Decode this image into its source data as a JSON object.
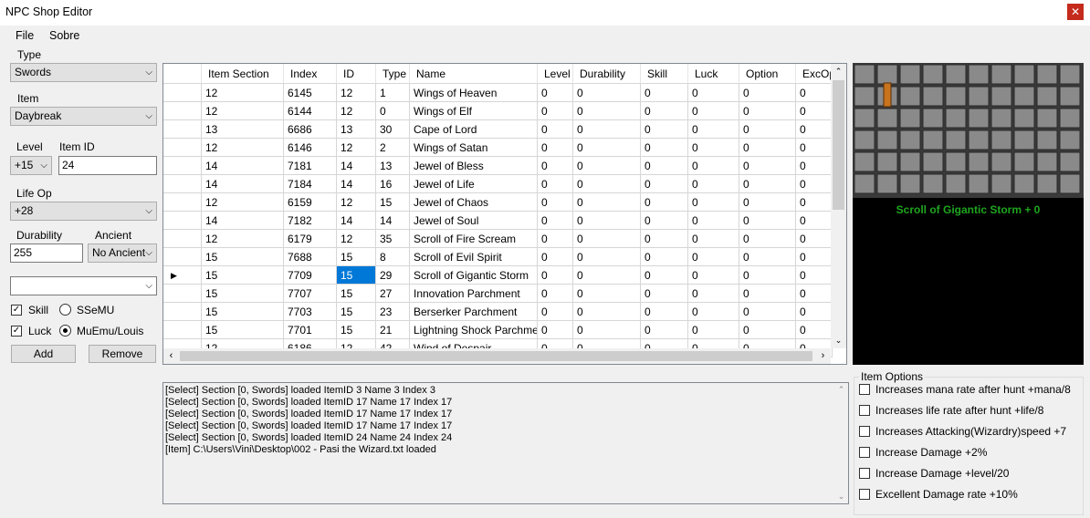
{
  "window": {
    "title": "NPC Shop Editor",
    "close_glyph": "✕"
  },
  "menu": {
    "file": "File",
    "sobre": "Sobre"
  },
  "left": {
    "type_label": "Type",
    "type_value": "Swords",
    "item_label": "Item",
    "item_value": "Daybreak",
    "level_label": "Level",
    "level_value": "+15",
    "item_id_label": "Item ID",
    "item_id_value": "24",
    "life_op_label": "Life Op",
    "life_op_value": "+28",
    "durability_label": "Durability",
    "durability_value": "255",
    "ancient_label": "Ancient",
    "ancient_value": "No Ancient",
    "extra_value": "",
    "skill_label": "Skill",
    "skill_checked": true,
    "luck_label": "Luck",
    "luck_checked": true,
    "ssemu_label": "SSeMU",
    "ssemu_selected": false,
    "muemu_label": "MuEmu/Louis",
    "muemu_selected": true,
    "add_label": "Add",
    "remove_label": "Remove"
  },
  "grid": {
    "columns": [
      "Item Section",
      "Index",
      "ID",
      "Type",
      "Name",
      "Level",
      "Durability",
      "Skill",
      "Luck",
      "Option",
      "ExcOp"
    ],
    "rows": [
      [
        "12",
        "6145",
        "12",
        "1",
        "Wings of Heaven",
        "0",
        "0",
        "0",
        "0",
        "0",
        "0"
      ],
      [
        "12",
        "6144",
        "12",
        "0",
        "Wings of Elf",
        "0",
        "0",
        "0",
        "0",
        "0",
        "0"
      ],
      [
        "13",
        "6686",
        "13",
        "30",
        "Cape of Lord",
        "0",
        "0",
        "0",
        "0",
        "0",
        "0"
      ],
      [
        "12",
        "6146",
        "12",
        "2",
        "Wings of Satan",
        "0",
        "0",
        "0",
        "0",
        "0",
        "0"
      ],
      [
        "14",
        "7181",
        "14",
        "13",
        "Jewel of Bless",
        "0",
        "0",
        "0",
        "0",
        "0",
        "0"
      ],
      [
        "14",
        "7184",
        "14",
        "16",
        "Jewel of Life",
        "0",
        "0",
        "0",
        "0",
        "0",
        "0"
      ],
      [
        "12",
        "6159",
        "12",
        "15",
        "Jewel of Chaos",
        "0",
        "0",
        "0",
        "0",
        "0",
        "0"
      ],
      [
        "14",
        "7182",
        "14",
        "14",
        "Jewel of Soul",
        "0",
        "0",
        "0",
        "0",
        "0",
        "0"
      ],
      [
        "12",
        "6179",
        "12",
        "35",
        "Scroll of Fire Scream",
        "0",
        "0",
        "0",
        "0",
        "0",
        "0"
      ],
      [
        "15",
        "7688",
        "15",
        "8",
        "Scroll of Evil Spirit",
        "0",
        "0",
        "0",
        "0",
        "0",
        "0"
      ],
      [
        "15",
        "7709",
        "15",
        "29",
        "Scroll of Gigantic Storm",
        "0",
        "0",
        "0",
        "0",
        "0",
        "0"
      ],
      [
        "15",
        "7707",
        "15",
        "27",
        "Innovation Parchment",
        "0",
        "0",
        "0",
        "0",
        "0",
        "0"
      ],
      [
        "15",
        "7703",
        "15",
        "23",
        "Berserker Parchment",
        "0",
        "0",
        "0",
        "0",
        "0",
        "0"
      ],
      [
        "15",
        "7701",
        "15",
        "21",
        "Lightning Shock Parchment",
        "0",
        "0",
        "0",
        "0",
        "0",
        "0"
      ],
      [
        "12",
        "6186",
        "12",
        "42",
        "Wind of Despair",
        "0",
        "0",
        "0",
        "0",
        "0",
        "0"
      ]
    ],
    "current_row_marker": "▶",
    "current_row": 10,
    "selected_column": 2,
    "selection_color": "#0078d7"
  },
  "preview": {
    "item_name": "Scroll of Gigantic Storm + 0",
    "name_color": "#1fa51f"
  },
  "log": {
    "lines": [
      "[Select] Section [0, Swords] loaded ItemID 3 Name 3 Index 3",
      "[Select] Section [0, Swords] loaded ItemID 17 Name 17 Index 17",
      "[Select] Section [0, Swords] loaded ItemID 17 Name 17 Index 17",
      "[Select] Section [0, Swords] loaded ItemID 17 Name 17 Index 17",
      "[Select] Section [0, Swords] loaded ItemID 24 Name 24 Index 24",
      "[Item] C:\\Users\\Vini\\Desktop\\002 - Pasi the Wizard.txt loaded"
    ]
  },
  "item_options": {
    "title": "Item Options",
    "options": [
      {
        "label": "Increases mana rate after hunt +mana/8",
        "checked": false
      },
      {
        "label": "Increases life rate after hunt +life/8",
        "checked": false
      },
      {
        "label": "Increases Attacking(Wizardry)speed +7",
        "checked": false
      },
      {
        "label": "Increase Damage +2%",
        "checked": false
      },
      {
        "label": "Increase Damage +level/20",
        "checked": false
      },
      {
        "label": "Excellent Damage rate +10%",
        "checked": false
      }
    ]
  }
}
